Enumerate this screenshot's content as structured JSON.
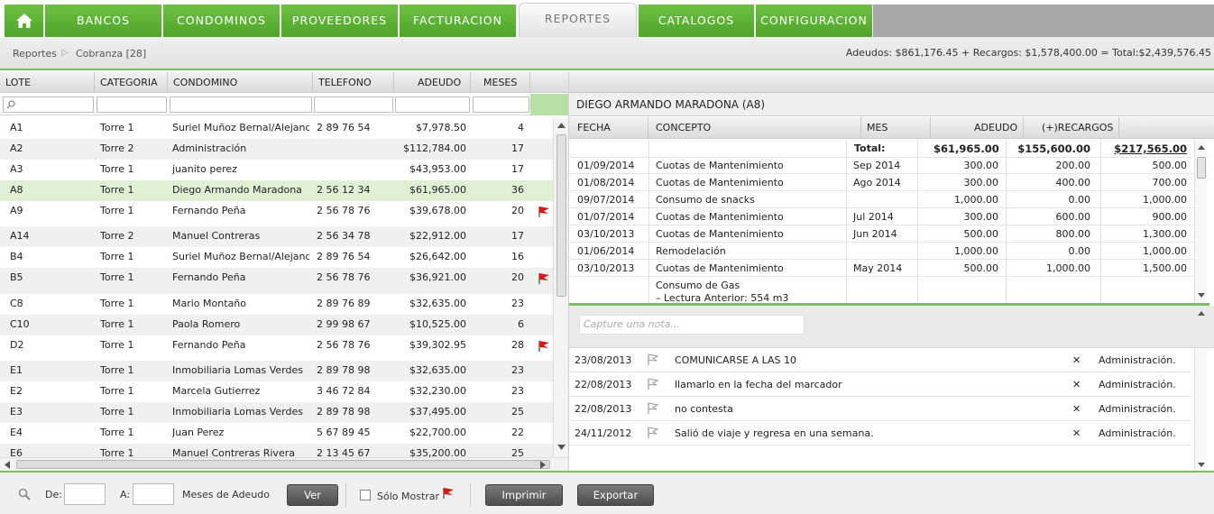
{
  "nav": {
    "tabs": [
      {
        "label": "BANCOS"
      },
      {
        "label": "CONDOMINOS"
      },
      {
        "label": "PROVEEDORES"
      },
      {
        "label": "FACTURACION"
      },
      {
        "label": "REPORTES"
      },
      {
        "label": "CATALOGOS"
      },
      {
        "label": "CONFIGURACION"
      }
    ],
    "active": "REPORTES"
  },
  "breadcrumb": {
    "root": "Reportes",
    "current": "Cobranza [28]"
  },
  "summary": "Adeudos: $861,176.45 + Recargos: $1,578,400.00 = Total:$2,439,576.45",
  "grid": {
    "columns": [
      "LOTE",
      "CATEGORIA",
      "CONDOMINO",
      "TELEFONO",
      "ADEUDO",
      "MESES"
    ],
    "rows": [
      {
        "lote": "A1",
        "categoria": "Torre 1",
        "condomino": "Suriel Muñoz Bernal/Alejandr...",
        "telefono": "2 89 76 54",
        "adeudo": "$7,978.50",
        "meses": "4",
        "flag": false
      },
      {
        "lote": "A2",
        "categoria": "Torre 2",
        "condomino": "Administración",
        "telefono": "",
        "adeudo": "$112,784.00",
        "meses": "17",
        "flag": false
      },
      {
        "lote": "A3",
        "categoria": "Torre 1",
        "condomino": "juanito perez",
        "telefono": "",
        "adeudo": "$43,953.00",
        "meses": "17",
        "flag": false
      },
      {
        "lote": "A8",
        "categoria": "Torre 1",
        "condomino": "Diego Armando Maradona",
        "telefono": "2 56 12 34",
        "adeudo": "$61,965.00",
        "meses": "36",
        "flag": false,
        "selected": true
      },
      {
        "lote": "A9",
        "categoria": "Torre 1",
        "condomino": "Fernando Peña",
        "telefono": "2 56 78 76",
        "adeudo": "$39,678.00",
        "meses": "20",
        "flag": true
      },
      {
        "lote": "A14",
        "categoria": "Torre 2",
        "condomino": "Manuel Contreras",
        "telefono": "2 56 34 78",
        "adeudo": "$22,912.00",
        "meses": "17",
        "flag": false
      },
      {
        "lote": "B4",
        "categoria": "Torre 1",
        "condomino": "Suriel Muñoz Bernal/Alejandr...",
        "telefono": "2 89 76 54",
        "adeudo": "$26,642.00",
        "meses": "16",
        "flag": false
      },
      {
        "lote": "B5",
        "categoria": "Torre 1",
        "condomino": "Fernando Peña",
        "telefono": "2 56 78 76",
        "adeudo": "$36,921.00",
        "meses": "20",
        "flag": true
      },
      {
        "lote": "C8",
        "categoria": "Torre 1",
        "condomino": "Mario Montaño",
        "telefono": "2 89 76 89",
        "adeudo": "$32,635.00",
        "meses": "23",
        "flag": false
      },
      {
        "lote": "C10",
        "categoria": "Torre 1",
        "condomino": "Paola Romero",
        "telefono": "2 99 98 67",
        "adeudo": "$10,525.00",
        "meses": "6",
        "flag": false
      },
      {
        "lote": "D2",
        "categoria": "Torre 1",
        "condomino": "Fernando Peña",
        "telefono": "2 56 78 76",
        "adeudo": "$39,302.95",
        "meses": "28",
        "flag": true
      },
      {
        "lote": "E1",
        "categoria": "Torre 1",
        "condomino": "Inmobiliaria Lomas Verdes",
        "telefono": "2 89 78 98",
        "adeudo": "$32,635.00",
        "meses": "23",
        "flag": false
      },
      {
        "lote": "E2",
        "categoria": "Torre 1",
        "condomino": "Marcela Gutierrez",
        "telefono": "3 46 72 84",
        "adeudo": "$32,230.00",
        "meses": "23",
        "flag": false
      },
      {
        "lote": "E3",
        "categoria": "Torre 1",
        "condomino": "Inmobiliaria Lomas Verdes",
        "telefono": "2 89 78 98",
        "adeudo": "$37,495.00",
        "meses": "25",
        "flag": false
      },
      {
        "lote": "E4",
        "categoria": "Torre 1",
        "condomino": "Juan Perez",
        "telefono": "5 67 89 45",
        "adeudo": "$22,700.00",
        "meses": "22",
        "flag": false
      },
      {
        "lote": "E6",
        "categoria": "Torre 1",
        "condomino": "Manuel Contreras Rivera",
        "telefono": "2 13 45 67",
        "adeudo": "$35,200.00",
        "meses": "25",
        "flag": false
      }
    ]
  },
  "detail": {
    "title": "DIEGO ARMANDO MARADONA (A8)",
    "columns": [
      "FECHA",
      "CONCEPTO",
      "MES",
      "ADEUDO",
      "(+)RECARGOS"
    ],
    "total": {
      "label": "Total:",
      "adeudo": "$61,965.00",
      "recargos": "$155,600.00",
      "total": "$217,565.00"
    },
    "rows": [
      {
        "fecha": "01/09/2014",
        "concepto": "Cuotas de Mantenimiento",
        "mes": "Sep 2014",
        "adeudo": "300.00",
        "recargos": "200.00",
        "total": "500.00"
      },
      {
        "fecha": "01/08/2014",
        "concepto": "Cuotas de Mantenimiento",
        "mes": "Ago 2014",
        "adeudo": "300.00",
        "recargos": "400.00",
        "total": "700.00"
      },
      {
        "fecha": "09/07/2014",
        "concepto": "Consumo de snacks",
        "mes": "",
        "adeudo": "1,000.00",
        "recargos": "0.00",
        "total": "1,000.00"
      },
      {
        "fecha": "01/07/2014",
        "concepto": "Cuotas de Mantenimiento",
        "mes": "Jul 2014",
        "adeudo": "300.00",
        "recargos": "600.00",
        "total": "900.00"
      },
      {
        "fecha": "03/10/2013",
        "concepto": "Cuotas de Mantenimiento",
        "mes": "Jun 2014",
        "adeudo": "500.00",
        "recargos": "800.00",
        "total": "1,300.00"
      },
      {
        "fecha": "01/06/2014",
        "concepto": "Remodelación",
        "mes": "",
        "adeudo": "1,000.00",
        "recargos": "0.00",
        "total": "1,000.00"
      },
      {
        "fecha": "03/10/2013",
        "concepto": "Cuotas de Mantenimiento",
        "mes": "May 2014",
        "adeudo": "500.00",
        "recargos": "1,000.00",
        "total": "1,500.00"
      }
    ],
    "partial_row": {
      "line1": "Consumo de Gas",
      "line2": "– Lectura Anterior: 554 m3"
    }
  },
  "notes": {
    "placeholder": "Capture una nota...",
    "items": [
      {
        "fecha": "23/08/2013",
        "texto": "COMUNICARSE A LAS 10",
        "autor": "Administración."
      },
      {
        "fecha": "22/08/2013",
        "texto": "llamarlo en la fecha del marcador",
        "autor": "Administración."
      },
      {
        "fecha": "22/08/2013",
        "texto": "no contesta",
        "autor": "Administración."
      },
      {
        "fecha": "24/11/2012",
        "texto": "Salió de viaje y regresa en una semana.",
        "autor": "Administración."
      }
    ]
  },
  "footer": {
    "de_label": "De:",
    "a_label": "A:",
    "meses_label": "Meses de Adeudo",
    "ver_label": "Ver",
    "solo_label": "Sólo Mostrar",
    "imprimir_label": "Imprimir",
    "exportar_label": "Exportar"
  },
  "colors": {
    "accent": "#5cb234",
    "selected_row": "#dff0d4",
    "flag": "#d21a1a"
  }
}
